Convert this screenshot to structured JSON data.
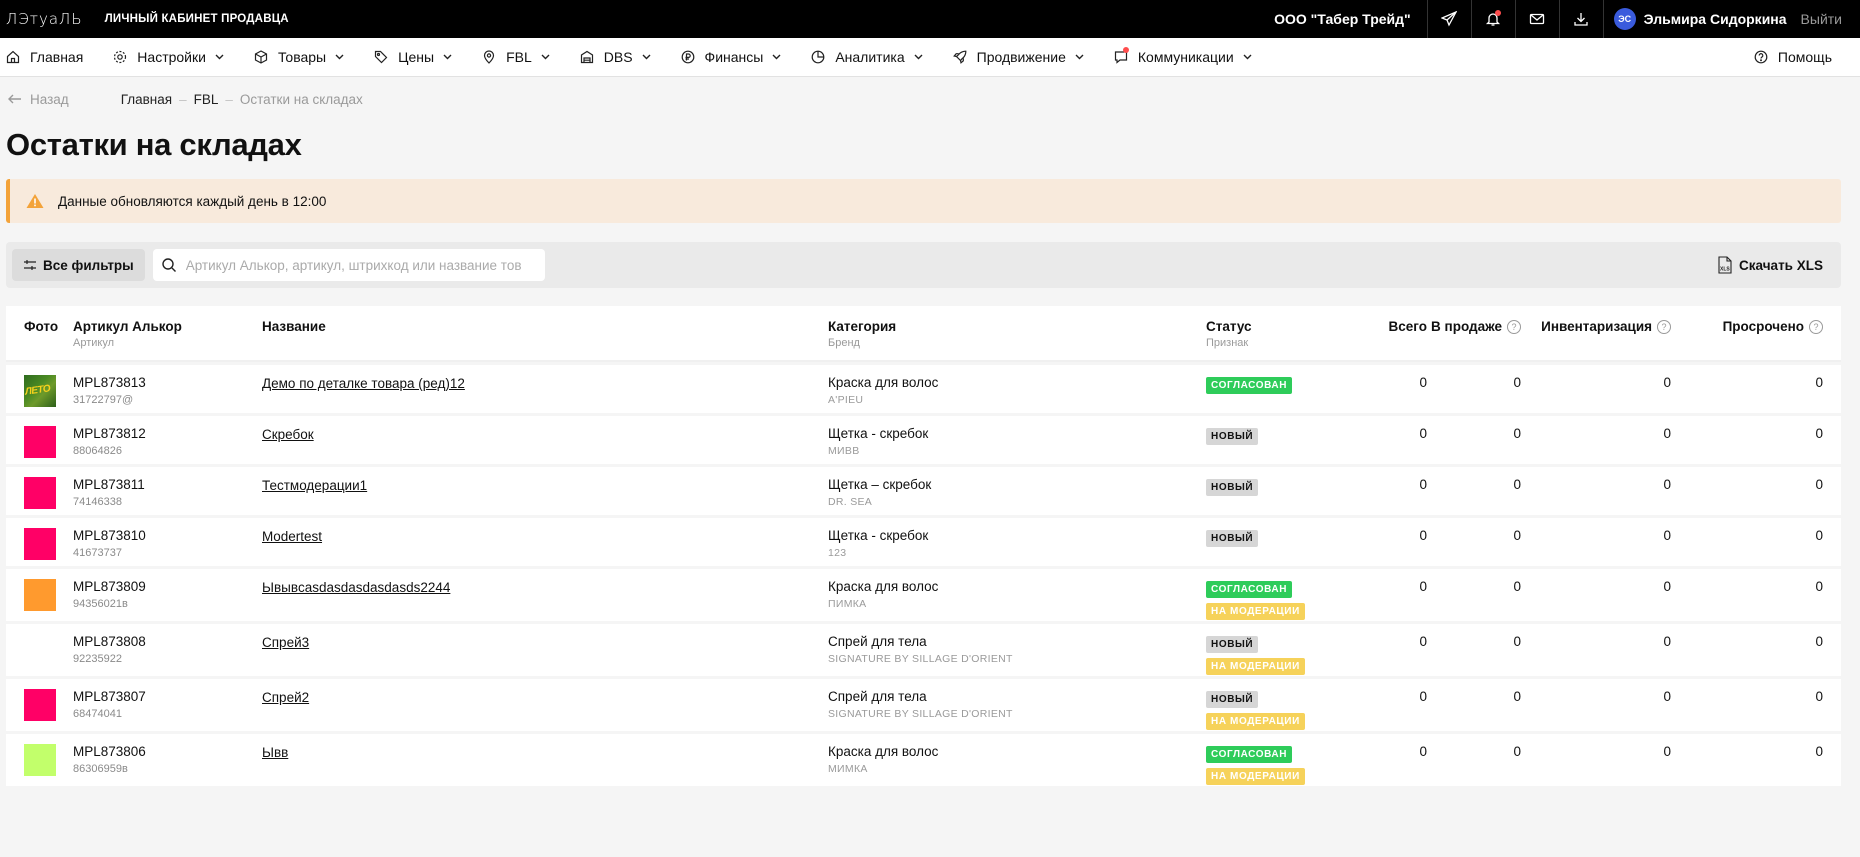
{
  "topbar": {
    "logo_text": "ЛЭтуаЛЬ",
    "cabinet_label": "ЛИЧНЫЙ КАБИНЕТ ПРОДАВЦА",
    "company": "ООО \"Табер Трейд\"",
    "user_initials": "ЭС",
    "user_name": "Эльмира Сидоркина",
    "logout_label": "Выйти"
  },
  "nav": {
    "items": [
      {
        "label": "Главная",
        "icon": "home-icon"
      },
      {
        "label": "Настройки",
        "icon": "gear-icon"
      },
      {
        "label": "Товары",
        "icon": "box-icon"
      },
      {
        "label": "Цены",
        "icon": "tag-icon"
      },
      {
        "label": "FBL",
        "icon": "pin-icon"
      },
      {
        "label": "DBS",
        "icon": "warehouse-icon"
      },
      {
        "label": "Финансы",
        "icon": "ruble-icon"
      },
      {
        "label": "Аналитика",
        "icon": "chart-pie-icon"
      },
      {
        "label": "Продвижение",
        "icon": "rocket-icon"
      },
      {
        "label": "Коммуникации",
        "icon": "chat-icon"
      }
    ],
    "help_label": "Помощь"
  },
  "breadcrumbs": {
    "back_label": "Назад",
    "items": [
      "Главная",
      "FBL",
      "Остатки на складах"
    ]
  },
  "page_title": "Остатки на складах",
  "alert_text": "Данные обновляются каждый день в 12:00",
  "toolbar": {
    "filters_label": "Все фильтры",
    "search_placeholder": "Артикул Алькор, артикул, штрихкод или название тов",
    "download_label": "Скачать XLS"
  },
  "table": {
    "headers": {
      "photo": "Фото",
      "article": "Артикул Алькор",
      "article_sub": "Артикул",
      "name": "Название",
      "category": "Категория",
      "category_sub": "Бренд",
      "status": "Статус",
      "status_sub": "Признак",
      "total": "Всего",
      "on_sale": "В продаже",
      "inventory": "Инвентаризация",
      "expired": "Просрочено"
    },
    "rows": [
      {
        "photo": "image",
        "photo_color": "#3d7a22",
        "article": "MPL873813",
        "sku": "31722797@",
        "name": "Демо по деталке товара (ред)12",
        "category": "Краска для волос",
        "brand": "A'PIEU",
        "statuses": [
          {
            "label": "согласован",
            "kind": "green"
          }
        ],
        "total": "0",
        "on_sale": "0",
        "inventory": "0",
        "expired": "0"
      },
      {
        "photo": "color",
        "photo_color": "#ff0066",
        "article": "MPL873812",
        "sku": "88064826",
        "name": "Скребок",
        "category": "Щетка - скребок",
        "brand": "МИВВ",
        "statuses": [
          {
            "label": "новый",
            "kind": "gray"
          }
        ],
        "total": "0",
        "on_sale": "0",
        "inventory": "0",
        "expired": "0"
      },
      {
        "photo": "color",
        "photo_color": "#ff0066",
        "article": "MPL873811",
        "sku": "74146338",
        "name": "Тестмодерации1",
        "category": "Щетка – скребок",
        "brand": "DR. SEA",
        "statuses": [
          {
            "label": "новый",
            "kind": "gray"
          }
        ],
        "total": "0",
        "on_sale": "0",
        "inventory": "0",
        "expired": "0"
      },
      {
        "photo": "color",
        "photo_color": "#ff0066",
        "article": "MPL873810",
        "sku": "41673737",
        "name": "Modertest",
        "category": "Щетка - скребок",
        "brand": "123",
        "statuses": [
          {
            "label": "новый",
            "kind": "gray"
          }
        ],
        "total": "0",
        "on_sale": "0",
        "inventory": "0",
        "expired": "0"
      },
      {
        "photo": "color",
        "photo_color": "#ff9a2e",
        "article": "MPL873809",
        "sku": "94356021в",
        "name": "Ывывcasdasdasdasdasds2244",
        "category": "Краска для волос",
        "brand": "ПИМКА",
        "statuses": [
          {
            "label": "согласован",
            "kind": "green"
          },
          {
            "label": "на модерации",
            "kind": "yellow"
          }
        ],
        "total": "0",
        "on_sale": "0",
        "inventory": "0",
        "expired": "0"
      },
      {
        "photo": "none",
        "photo_color": "#ffffff",
        "article": "MPL873808",
        "sku": "92235922",
        "name": "Спрей3",
        "category": "Спрей для тела",
        "brand": "SIGNATURE BY SILLAGE D'ORIENT",
        "statuses": [
          {
            "label": "новый",
            "kind": "gray"
          },
          {
            "label": "на модерации",
            "kind": "yellow"
          }
        ],
        "total": "0",
        "on_sale": "0",
        "inventory": "0",
        "expired": "0"
      },
      {
        "photo": "color",
        "photo_color": "#ff0066",
        "article": "MPL873807",
        "sku": "68474041",
        "name": "Спрей2",
        "category": "Спрей для тела",
        "brand": "SIGNATURE BY SILLAGE D'ORIENT",
        "statuses": [
          {
            "label": "новый",
            "kind": "gray"
          },
          {
            "label": "на модерации",
            "kind": "yellow"
          }
        ],
        "total": "0",
        "on_sale": "0",
        "inventory": "0",
        "expired": "0"
      },
      {
        "photo": "color",
        "photo_color": "#c2ff6b",
        "article": "MPL873806",
        "sku": "86306959в",
        "name": "Ывв",
        "category": "Краска для волос",
        "brand": "МИМКА",
        "statuses": [
          {
            "label": "согласован",
            "kind": "green"
          },
          {
            "label": "на модерации",
            "kind": "yellow"
          }
        ],
        "total": "0",
        "on_sale": "0",
        "inventory": "0",
        "expired": "0"
      }
    ]
  },
  "colors": {
    "topbar_bg": "#000000",
    "alert_bg": "#f8eadc",
    "alert_accent": "#f3a33a",
    "status_green": "#2ecc5a",
    "status_gray": "#d6d6d6",
    "status_yellow": "#f6d25a",
    "notification_dot": "#ff4d4d"
  }
}
